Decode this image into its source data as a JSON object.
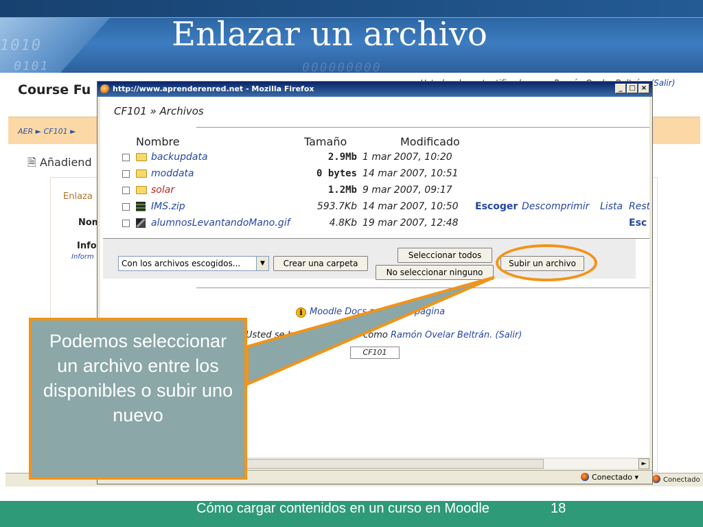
{
  "slide": {
    "title": "Enlazar un archivo",
    "binary_a": "1010",
    "binary_b": "0101",
    "binary_c": "000000000",
    "footer": "Cómo cargar contenidos en un curso en Moodle",
    "page_number": "18",
    "callout": "Podemos seleccionar un archivo entre los disponibles o subir uno nuevo"
  },
  "background": {
    "course_title": "Course Fu",
    "login_text": "Usted se ha autentificado como Ramón Ovelar Beltrán.",
    "login_logout": "(Salir)",
    "nav": "AER ► CF101 ► ",
    "heading": "Añadiend",
    "panel_label1": "Enlaza",
    "panel_label2": "Nom",
    "panel_label3": "Info",
    "panel_label4": "Inform",
    "status_right": "Conectado"
  },
  "window": {
    "title": "http://www.aprenderenred.net - Mozilla Firefox",
    "minimize": "_",
    "maximize": "□",
    "close": "×",
    "status": "Conectado"
  },
  "page": {
    "breadcrumb": "CF101 » Archivos",
    "columns": {
      "name": "Nombre",
      "size": "Tamaño",
      "modified": "Modificado"
    },
    "files": [
      {
        "name": "backupdata",
        "size": "2.9Mb",
        "date": "1 mar 2007, 10:20",
        "type": "folder"
      },
      {
        "name": "moddata",
        "size": "0 bytes",
        "date": "14 mar 2007, 10:51",
        "type": "folder"
      },
      {
        "name": "solar",
        "size": "1.2Mb",
        "date": "9 mar 2007, 09:17",
        "type": "folder"
      },
      {
        "name": "IMS.zip",
        "size": "593.7Kb",
        "date": "14 mar 2007, 10:50",
        "type": "zip",
        "action_choose": "Escoger",
        "action_unzip": "Descomprimir",
        "action_list": "Lista",
        "action_restore": "Rest"
      },
      {
        "name": "alumnosLevantandoMano.gif",
        "size": "4.8Kb",
        "date": "19 mar 2007, 12:48",
        "type": "gif",
        "action_choose": "Esc"
      }
    ],
    "with_selected": "Con los archivos escogidos...",
    "create_folder": "Crear una carpeta",
    "select_all": "Seleccionar todos",
    "select_none": "No seleccionar ninguno",
    "upload": "Subir un archivo",
    "docs_link": "Moodle Docs para esta página",
    "logged_prefix": "Usted se ha autentificado como",
    "logged_user": "Ramón Ovelar Beltrán.",
    "logged_logout": "(Salir)",
    "course_button": "CF101"
  },
  "colors": {
    "accent": "#f39317",
    "callout_bg": "#8ba7a7",
    "footer_bg": "#2e9a78",
    "link_blue": "#2546a3"
  }
}
